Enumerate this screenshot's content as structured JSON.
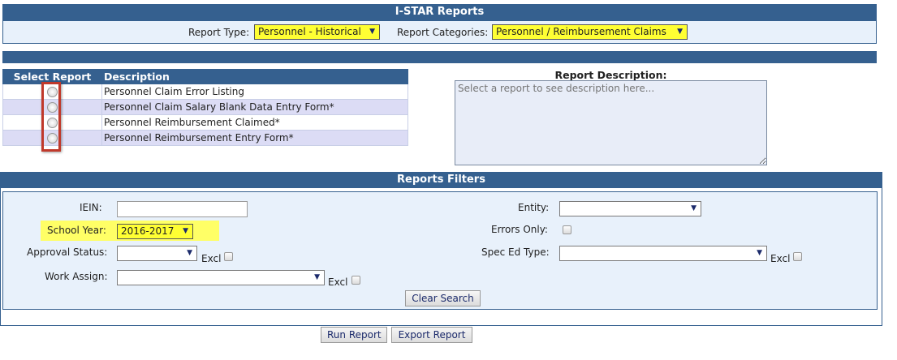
{
  "header": {
    "title": "I-STAR Reports",
    "report_type_label": "Report Type:",
    "report_type_value": "Personnel - Historical",
    "report_categories_label": "Report Categories:",
    "report_categories_value": "Personnel / Reimbursement Claims"
  },
  "report_table": {
    "col_select": "Select Report",
    "col_description": "Description",
    "rows": [
      {
        "description": "Personnel Claim Error Listing"
      },
      {
        "description": "Personnel Claim Salary Blank Data Entry Form*"
      },
      {
        "description": "Personnel Reimbursement Claimed*"
      },
      {
        "description": "Personnel Reimbursement Entry Form*"
      }
    ]
  },
  "description_panel": {
    "title": "Report Description:",
    "placeholder": "Select a report to see description here..."
  },
  "filters": {
    "title": "Reports Filters",
    "iein_label": "IEIN:",
    "iein_value": "",
    "school_year_label": "School Year:",
    "school_year_value": "2016-2017",
    "approval_status_label": "Approval Status:",
    "approval_status_value": "",
    "work_assign_label": "Work Assign:",
    "work_assign_value": "",
    "entity_label": "Entity:",
    "entity_value": "",
    "errors_only_label": "Errors Only:",
    "spec_ed_label": "Spec Ed Type:",
    "spec_ed_value": "",
    "excl_label": "Excl",
    "clear_search_label": "Clear Search"
  },
  "actions": {
    "run_report": "Run Report",
    "export_report": "Export Report"
  },
  "colors": {
    "header_bar": "#35608f",
    "panel_bg": "#e8f1fb",
    "highlight": "#ffff33",
    "alt_row": "#dcdcf5",
    "annotation_box": "#c0392b"
  }
}
